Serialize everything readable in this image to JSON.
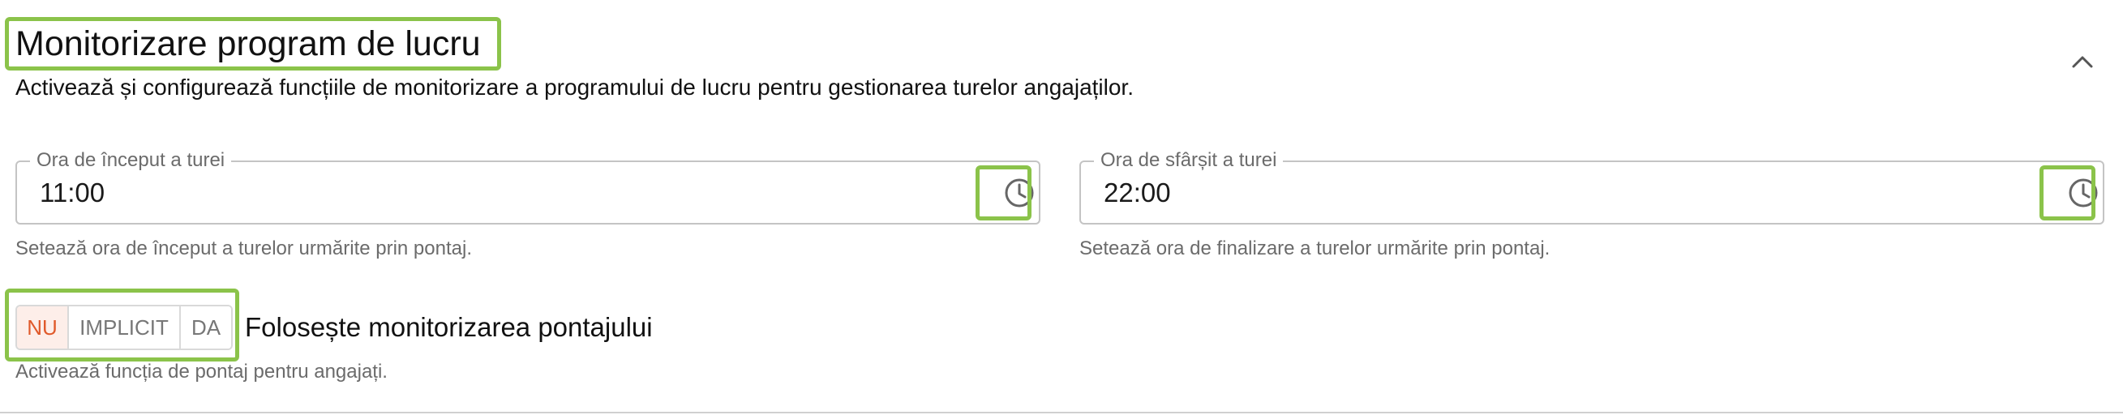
{
  "section": {
    "title": "Monitorizare program de lucru",
    "description": "Activează și configurează funcțiile de monitorizare a programului de lucru pentru gestionarea turelor angajaților.",
    "collapse_icon": "chevron-up-icon"
  },
  "shift_start": {
    "label": "Ora de început a turei",
    "value": "11:00",
    "helper": "Setează ora de început a turelor urmărite prin pontaj.",
    "icon": "clock-icon"
  },
  "shift_end": {
    "label": "Ora de sfârșit a turei",
    "value": "22:00",
    "helper": "Setează ora de finalizare a turelor urmărite prin pontaj.",
    "icon": "clock-icon"
  },
  "timesheet_toggle": {
    "options": [
      "NU",
      "IMPLICIT",
      "DA"
    ],
    "selected": "NU",
    "label": "Folosește monitorizarea pontajului",
    "helper": "Activează funcția de pontaj pentru angajați."
  },
  "colors": {
    "highlight": "#8bc34a",
    "selected_text": "#e05a2b",
    "selected_bg": "#fdeee9",
    "muted_text": "#6b6b6b",
    "border": "#c4c4c4"
  }
}
